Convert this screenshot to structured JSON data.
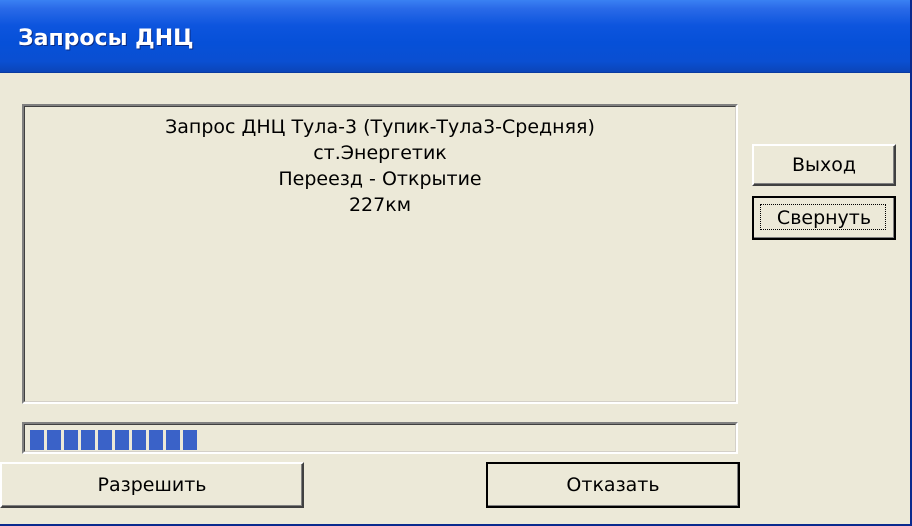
{
  "window": {
    "title": "Запросы ДНЦ"
  },
  "message": {
    "lines": [
      "Запрос ДНЦ Тула-3  (Тупик-Тула3-Средняя)",
      "ст.Энергетик",
      "Переезд - Открытие",
      "227км"
    ]
  },
  "progress": {
    "filled_segments": 10,
    "color": "#3a62c8"
  },
  "buttons": {
    "exit": "Выход",
    "minimize": "Свернуть",
    "allow": "Разрешить",
    "deny": "Отказать"
  },
  "colors": {
    "titlebar": "#0650d8",
    "face": "#ece9d8"
  }
}
